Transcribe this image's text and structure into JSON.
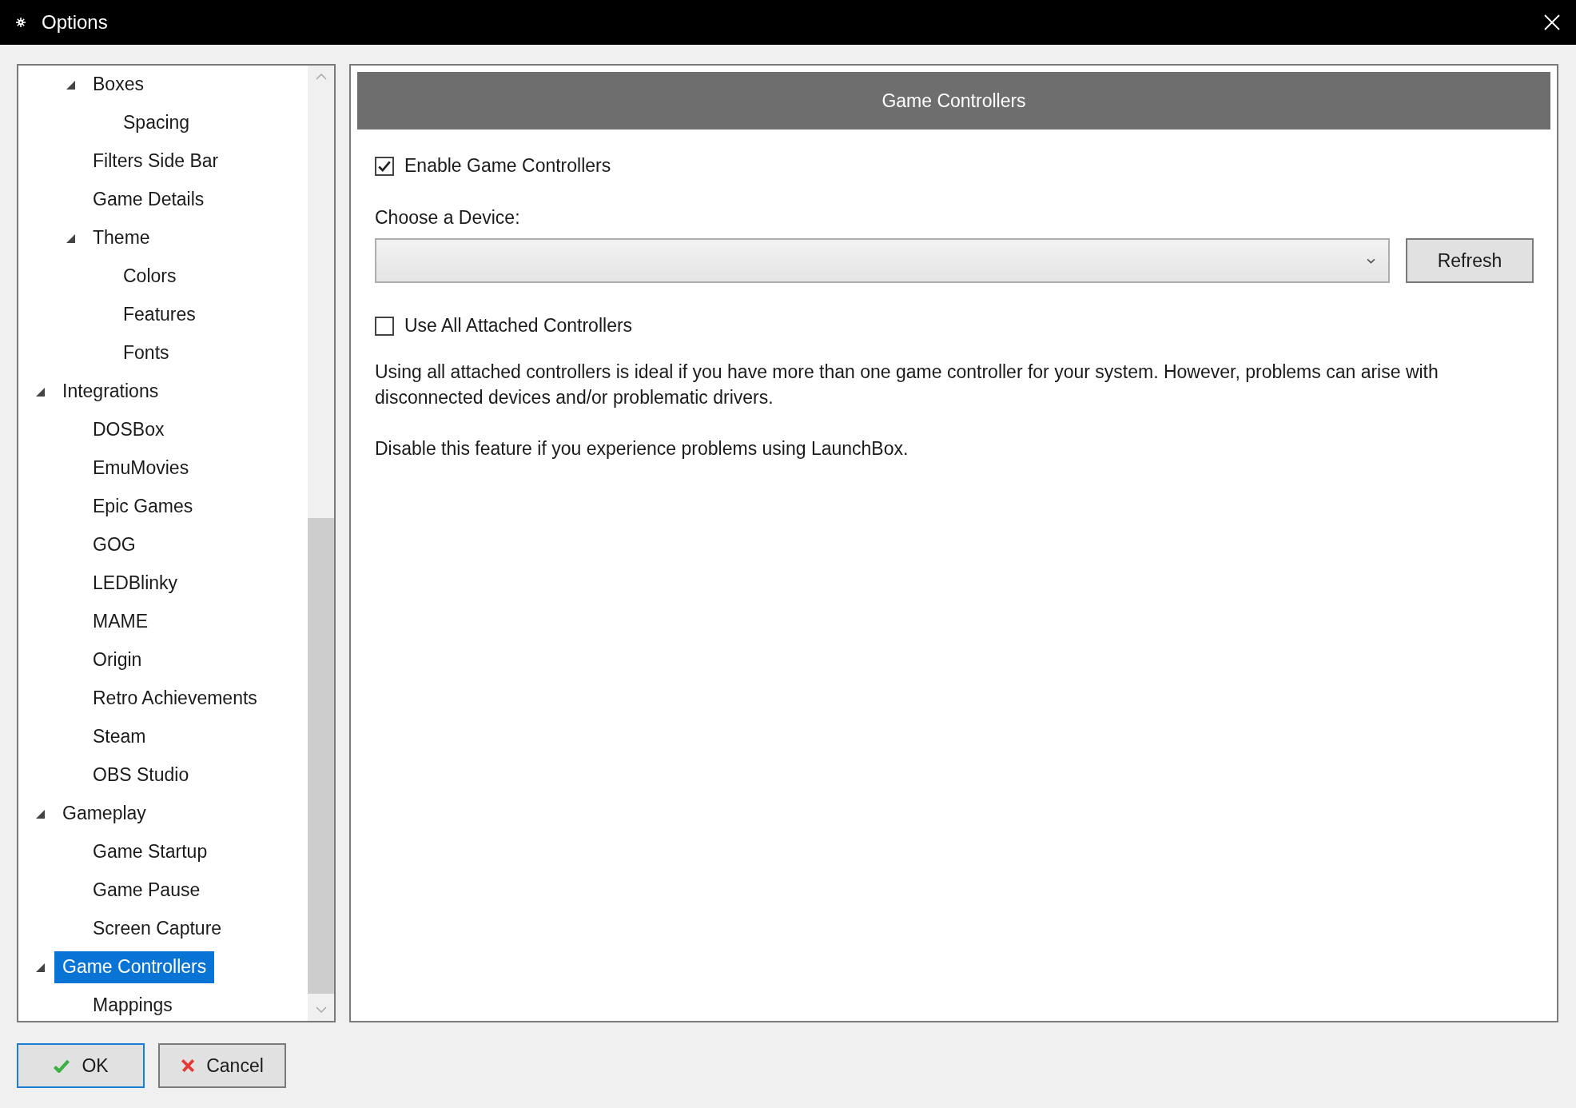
{
  "window": {
    "title": "Options"
  },
  "tree": {
    "items": [
      {
        "children": [
          {
            "label": "Boxes",
            "expanded": true,
            "selected": false,
            "children": [
              {
                "label": "Spacing",
                "selected": false
              }
            ]
          },
          {
            "label": "Filters Side Bar",
            "selected": false
          },
          {
            "label": "Game Details",
            "selected": false
          },
          {
            "label": "Theme",
            "expanded": true,
            "selected": false,
            "children": [
              {
                "label": "Colors",
                "selected": false
              },
              {
                "label": "Features",
                "selected": false
              },
              {
                "label": "Fonts",
                "selected": false
              }
            ]
          }
        ]
      },
      {
        "label": "Integrations",
        "expanded": true,
        "selected": false,
        "children": [
          {
            "label": "DOSBox",
            "selected": false
          },
          {
            "label": "EmuMovies",
            "selected": false
          },
          {
            "label": "Epic Games",
            "selected": false
          },
          {
            "label": "GOG",
            "selected": false
          },
          {
            "label": "LEDBlinky",
            "selected": false
          },
          {
            "label": "MAME",
            "selected": false
          },
          {
            "label": "Origin",
            "selected": false
          },
          {
            "label": "Retro Achievements",
            "selected": false
          },
          {
            "label": "Steam",
            "selected": false
          },
          {
            "label": "OBS Studio",
            "selected": false
          }
        ]
      },
      {
        "label": "Gameplay",
        "expanded": true,
        "selected": false,
        "children": [
          {
            "label": "Game Startup",
            "selected": false
          },
          {
            "label": "Game Pause",
            "selected": false
          },
          {
            "label": "Screen Capture",
            "selected": false
          }
        ]
      },
      {
        "label": "Game Controllers",
        "expanded": true,
        "selected": true,
        "children": [
          {
            "label": "Mappings",
            "selected": false
          }
        ]
      }
    ]
  },
  "panel": {
    "title": "Game Controllers",
    "enable_checkbox": {
      "label": "Enable Game Controllers",
      "checked": true
    },
    "device_label": "Choose a Device:",
    "refresh_button": "Refresh",
    "use_all_checkbox": {
      "label": "Use All Attached Controllers",
      "checked": false
    },
    "paragraphs": [
      "Using all attached controllers is ideal if you have more than one game controller for your system. However, problems can arise with disconnected devices and/or problematic drivers.",
      "Disable this feature if you experience problems using LaunchBox."
    ]
  },
  "buttons": [
    {
      "kind": "ok",
      "label": "OK"
    },
    {
      "kind": "cancel",
      "label": "Cancel"
    }
  ]
}
